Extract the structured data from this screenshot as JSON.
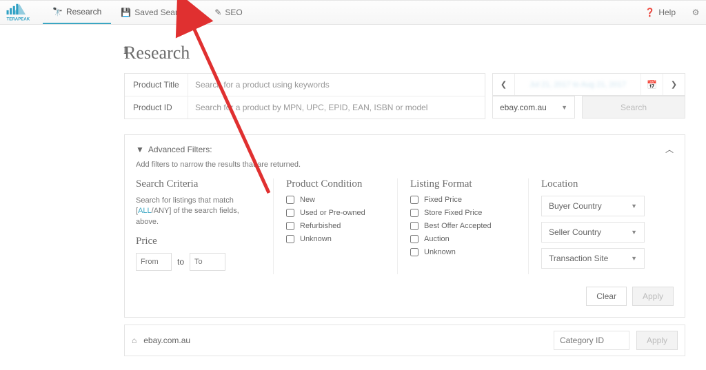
{
  "brand": "TERAPEAK",
  "nav": {
    "research": "Research",
    "saved": "Saved Searches",
    "seo": "SEO",
    "help": "Help"
  },
  "page_title": "Research",
  "fields": {
    "product_title_label": "Product Title",
    "product_title_placeholder": "Search for a product using keywords",
    "product_id_label": "Product ID",
    "product_id_placeholder": "Search for a product by MPN, UPC, EPID, EAN, ISBN or model"
  },
  "date_range_blurred": "Jul 21, 2017 to Aug 21, 2017",
  "site_selected": "ebay.com.au",
  "search_button": "Search",
  "adv": {
    "title": "Advanced Filters:",
    "subtitle": "Add filters to narrow the results that are returned.",
    "criteria": {
      "heading": "Search Criteria",
      "desc_pre": "Search for listings that match [",
      "all": "ALL",
      "slash": "/",
      "any": "ANY",
      "desc_post": "] of the search fields, above."
    },
    "price": {
      "heading": "Price",
      "from": "From",
      "to_word": "to",
      "to": "To"
    },
    "condition": {
      "heading": "Product Condition",
      "items": [
        "New",
        "Used or Pre-owned",
        "Refurbished",
        "Unknown"
      ]
    },
    "format": {
      "heading": "Listing Format",
      "items": [
        "Fixed Price",
        "Store Fixed Price",
        "Best Offer Accepted",
        "Auction",
        "Unknown"
      ]
    },
    "location": {
      "heading": "Location",
      "buyer": "Buyer Country",
      "seller": "Seller Country",
      "txn": "Transaction Site"
    },
    "clear": "Clear",
    "apply": "Apply"
  },
  "crumb": {
    "site": "ebay.com.au",
    "cat_placeholder": "Category ID",
    "apply": "Apply"
  }
}
